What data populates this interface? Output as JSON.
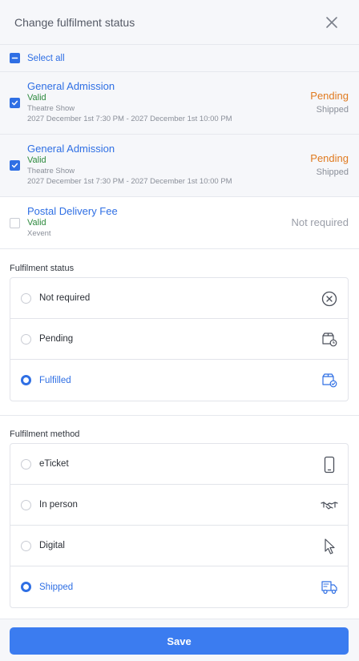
{
  "header": {
    "title": "Change fulfilment status",
    "close_icon": "close-icon"
  },
  "select_all": {
    "label": "Select all",
    "state": "indeterminate"
  },
  "items": [
    {
      "title": "General Admission",
      "validity": "Valid",
      "event": "Theatre Show",
      "dates": "2027 December 1st 7:30 PM - 2027 December 1st 10:00 PM",
      "status": "Pending",
      "method": "Shipped",
      "checked": true
    },
    {
      "title": "General Admission",
      "validity": "Valid",
      "event": "Theatre Show",
      "dates": "2027 December 1st 7:30 PM - 2027 December 1st 10:00 PM",
      "status": "Pending",
      "method": "Shipped",
      "checked": true
    },
    {
      "title": "Postal Delivery Fee",
      "validity": "Valid",
      "event": "Xevent",
      "status": "Not required",
      "checked": false
    }
  ],
  "fulfilment_status": {
    "label": "Fulfilment status",
    "options": [
      {
        "label": "Not required",
        "icon": "circle-x-icon",
        "selected": false
      },
      {
        "label": "Pending",
        "icon": "box-clock-icon",
        "selected": false
      },
      {
        "label": "Fulfilled",
        "icon": "box-check-icon",
        "selected": true
      }
    ]
  },
  "fulfilment_method": {
    "label": "Fulfilment method",
    "options": [
      {
        "label": "eTicket",
        "icon": "phone-icon",
        "selected": false
      },
      {
        "label": "In person",
        "icon": "handshake-icon",
        "selected": false
      },
      {
        "label": "Digital",
        "icon": "cursor-icon",
        "selected": false
      },
      {
        "label": "Shipped",
        "icon": "truck-icon",
        "selected": true
      }
    ]
  },
  "footer": {
    "save_label": "Save"
  },
  "colors": {
    "accent": "#2f6fe4",
    "pending": "#e07a1f",
    "valid": "#2e8a3e",
    "muted": "#8a8f99"
  }
}
